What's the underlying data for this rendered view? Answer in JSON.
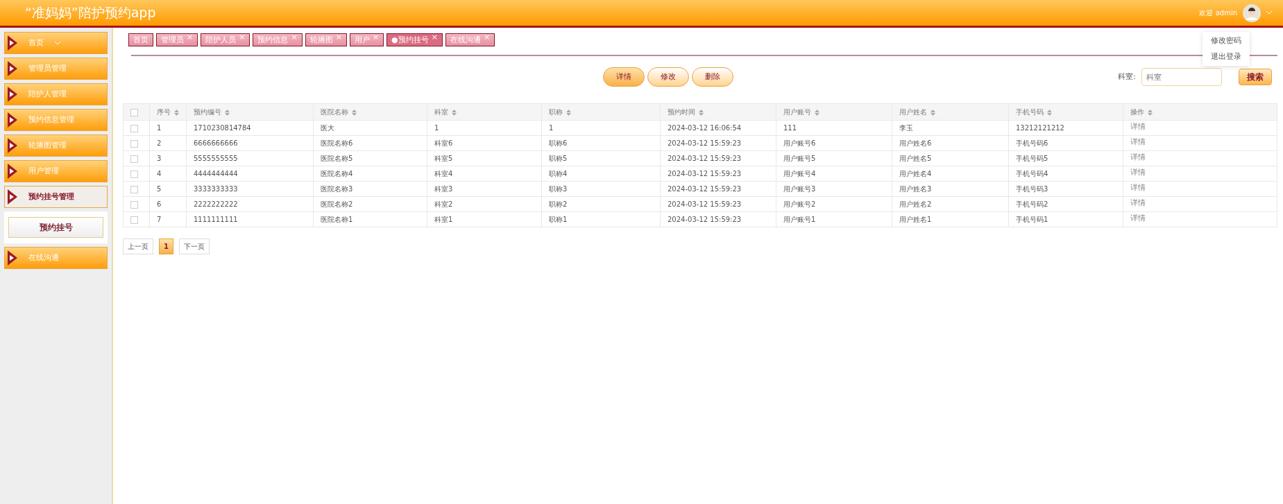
{
  "header": {
    "title": "“准妈妈”陪护预约app",
    "welcome": "欢迎 admin",
    "user_menu": [
      "修改密码",
      "退出登录"
    ]
  },
  "sidebar": {
    "items": [
      {
        "label": "首页",
        "selected": false,
        "expandable": true
      },
      {
        "label": "管理员管理",
        "selected": false,
        "expandable": false
      },
      {
        "label": "陪护人管理",
        "selected": false,
        "expandable": false
      },
      {
        "label": "预约信息管理",
        "selected": false,
        "expandable": false
      },
      {
        "label": "轮播图管理",
        "selected": false,
        "expandable": false
      },
      {
        "label": "用户管理",
        "selected": false,
        "expandable": false
      },
      {
        "label": "预约挂号管理",
        "selected": true,
        "expandable": false,
        "children": [
          {
            "label": "预约挂号"
          }
        ]
      },
      {
        "label": "在线沟通",
        "selected": false,
        "expandable": false
      }
    ]
  },
  "tabs": [
    {
      "label": "首页",
      "closable": false,
      "selected": false
    },
    {
      "label": "管理员",
      "closable": true,
      "selected": false
    },
    {
      "label": "陪护人员",
      "closable": true,
      "selected": false
    },
    {
      "label": "预约信息",
      "closable": true,
      "selected": false
    },
    {
      "label": "轮播图",
      "closable": true,
      "selected": false
    },
    {
      "label": "用户",
      "closable": true,
      "selected": false
    },
    {
      "label": "●预约挂号",
      "closable": true,
      "selected": true
    },
    {
      "label": "在线沟通",
      "closable": true,
      "selected": false
    }
  ],
  "close_glyph": "×",
  "actions": [
    "详情",
    "修改",
    "删除"
  ],
  "search": {
    "label": "科室:",
    "placeholder": "科室",
    "button": "搜索"
  },
  "table": {
    "select_all_checked": false,
    "columns": [
      "序号",
      "预约编号",
      "医院名称",
      "科室",
      "职称",
      "预约时间",
      "用户账号",
      "用户姓名",
      "手机号码",
      "操作"
    ],
    "rows": [
      {
        "checked": false,
        "cells": [
          "1",
          "1710230814784",
          "医大",
          "1",
          "1",
          "2024-03-12 16:06:54",
          "111",
          "李玉",
          "13212121212",
          "详情"
        ]
      },
      {
        "checked": false,
        "cells": [
          "2",
          "6666666666",
          "医院名称6",
          "科室6",
          "职称6",
          "2024-03-12 15:59:23",
          "用户账号6",
          "用户姓名6",
          "手机号码6",
          "详情"
        ]
      },
      {
        "checked": false,
        "cells": [
          "3",
          "5555555555",
          "医院名称5",
          "科室5",
          "职称5",
          "2024-03-12 15:59:23",
          "用户账号5",
          "用户姓名5",
          "手机号码5",
          "详情"
        ]
      },
      {
        "checked": false,
        "cells": [
          "4",
          "4444444444",
          "医院名称4",
          "科室4",
          "职称4",
          "2024-03-12 15:59:23",
          "用户账号4",
          "用户姓名4",
          "手机号码4",
          "详情"
        ]
      },
      {
        "checked": false,
        "cells": [
          "5",
          "3333333333",
          "医院名称3",
          "科室3",
          "职称3",
          "2024-03-12 15:59:23",
          "用户账号3",
          "用户姓名3",
          "手机号码3",
          "详情"
        ]
      },
      {
        "checked": false,
        "cells": [
          "6",
          "2222222222",
          "医院名称2",
          "科室2",
          "职称2",
          "2024-03-12 15:59:23",
          "用户账号2",
          "用户姓名2",
          "手机号码2",
          "详情"
        ]
      },
      {
        "checked": false,
        "cells": [
          "7",
          "1111111111",
          "医院名称1",
          "科室1",
          "职称1",
          "2024-03-12 15:59:23",
          "用户账号1",
          "用户姓名1",
          "手机号码1",
          "详情"
        ]
      }
    ]
  },
  "pagination": [
    {
      "label": "上一页",
      "selected": false
    },
    {
      "label": "1",
      "selected": true
    },
    {
      "label": "下一页",
      "selected": false
    }
  ]
}
